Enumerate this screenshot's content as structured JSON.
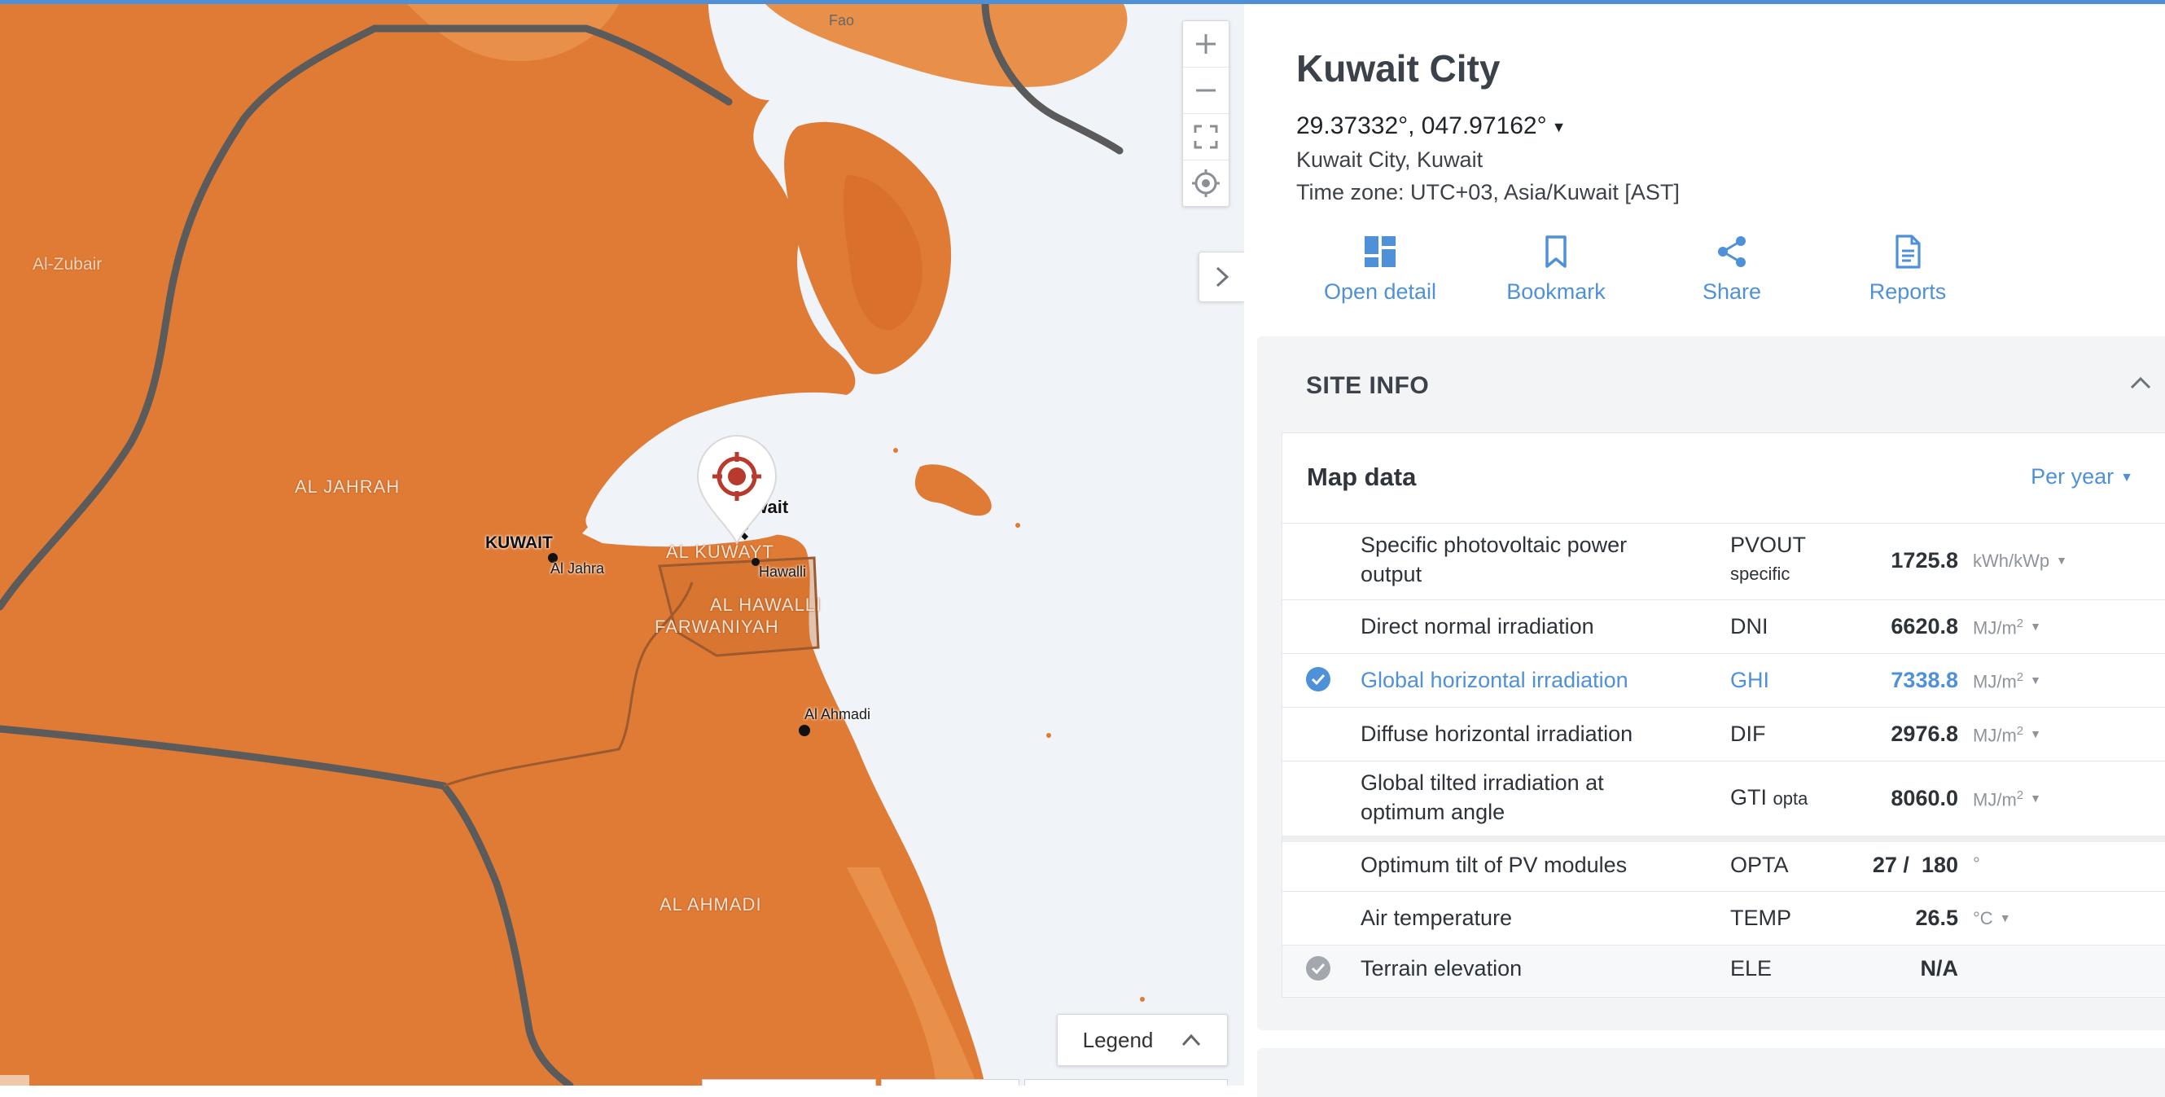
{
  "map": {
    "places": {
      "fao": "Fao",
      "al_zubair": "Al-Zubair",
      "al_jahrah": "AL JAHRAH",
      "kuwait_city_label": "KUWAIT",
      "al_jahra": "Al Jahra",
      "kuwait_partial": "uwait",
      "al_kuwayt": "AL KUWAYT",
      "hawalli": "Hawalli",
      "al_hawalli": "AL HAWALLI",
      "farwaniyah": "FARWANIYAH",
      "al_ahmadi_city": "Al Ahmadi",
      "al_ahmadi_region": "AL AHMADI"
    },
    "controls": {
      "zoom_in_icon": "plus-icon",
      "zoom_out_icon": "minus-icon",
      "fullscreen_icon": "fullscreen-icon",
      "locate_icon": "crosshair-icon",
      "collapse_icon": "chevron-right-icon"
    },
    "legend_label": "Legend",
    "colors": {
      "land": "#e07b35",
      "land_light": "#e89049",
      "water": "#f0f3f8",
      "border": "#5a5a5a",
      "pin": "#b83a2e"
    }
  },
  "site": {
    "title": "Kuwait City",
    "coordinates": "29.37332°, 047.97162°",
    "location": "Kuwait City, Kuwait",
    "timezone": "Time zone: UTC+03, Asia/Kuwait [AST]",
    "actions": [
      {
        "label": "Open detail",
        "icon": "dashboard-icon"
      },
      {
        "label": "Bookmark",
        "icon": "bookmark-icon"
      },
      {
        "label": "Share",
        "icon": "share-icon"
      },
      {
        "label": "Reports",
        "icon": "document-icon"
      }
    ]
  },
  "site_info": {
    "heading": "SITE INFO",
    "map_data": {
      "title": "Map data",
      "period": "Per year",
      "rows": [
        {
          "name_line1": "Specific photovoltaic power",
          "name_line2": "output",
          "abbr": "PVOUT",
          "abbr_sub": "specific",
          "value": "1725.8",
          "unit": "kWh/kWp",
          "has_dropdown": true
        },
        {
          "name": "Direct normal irradiation",
          "abbr": "DNI",
          "value": "6620.8",
          "unit_base": "MJ/m",
          "unit_sup": "2",
          "has_dropdown": true
        },
        {
          "name": "Global horizontal irradiation",
          "abbr": "GHI",
          "value": "7338.8",
          "unit_base": "MJ/m",
          "unit_sup": "2",
          "has_dropdown": true,
          "selected": true
        },
        {
          "name": "Diffuse horizontal irradiation",
          "abbr": "DIF",
          "value": "2976.8",
          "unit_base": "MJ/m",
          "unit_sup": "2",
          "has_dropdown": true
        },
        {
          "name_line1": "Global tilted irradiation at",
          "name_line2": "optimum angle",
          "abbr": "GTI",
          "abbr_sub": "opta",
          "value": "8060.0",
          "unit_base": "MJ/m",
          "unit_sup": "2",
          "has_dropdown": true
        },
        {
          "name": "Optimum tilt of PV modules",
          "abbr": "OPTA",
          "value_a": "27",
          "value_b": "180",
          "unit": "°"
        },
        {
          "name": "Air temperature",
          "abbr": "TEMP",
          "value": "26.5",
          "unit": "°C",
          "has_dropdown": true
        },
        {
          "name": "Terrain elevation",
          "abbr": "ELE",
          "value": "N/A",
          "checked_grey": true
        }
      ]
    }
  }
}
